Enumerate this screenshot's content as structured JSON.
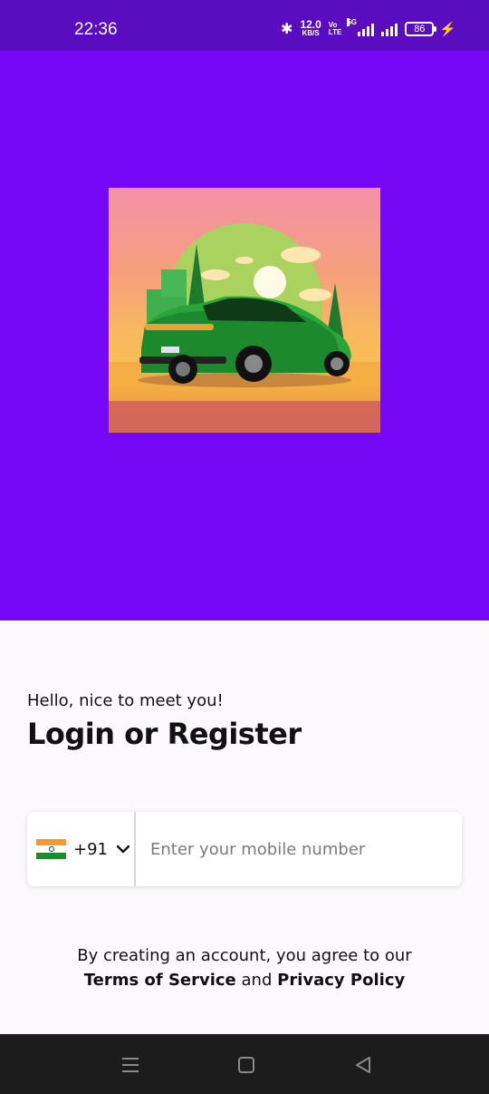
{
  "status_bar": {
    "time": "22:36",
    "net_speed_value": "12.0",
    "net_speed_unit": "KB/S",
    "volte_top": "Vo",
    "volte_bottom": "LTE",
    "network_type": "5G",
    "battery_level": "86",
    "bluetooth_icon": "bluetooth-icon",
    "charging_icon": "bolt-icon"
  },
  "hero": {
    "background_color": "#7607f7",
    "image_icon": "car-illustration"
  },
  "login": {
    "greeting": "Hello, nice to meet you!",
    "title": "Login or Register",
    "country_code": "+91",
    "country_flag": "india-flag-icon",
    "mobile_placeholder": "Enter your mobile number",
    "mobile_value": "",
    "terms_prefix": "By creating an account, you agree to our",
    "terms_link": "Terms of Service",
    "terms_and": "and",
    "privacy_link": "Privacy Policy"
  },
  "nav_bar": {
    "menu_icon": "menu-icon",
    "home_icon": "home-square-icon",
    "back_icon": "back-triangle-icon"
  },
  "colors": {
    "accent": "#7607f7",
    "status_bar": "#5a0cc0",
    "nav_bar": "#1c1c1c"
  }
}
